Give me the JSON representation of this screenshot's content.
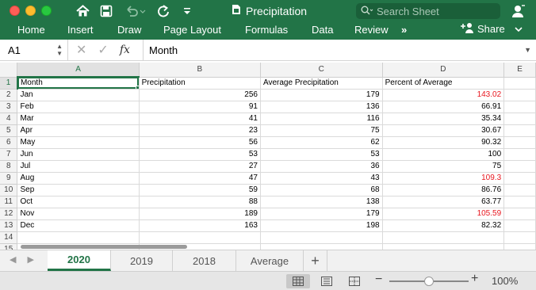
{
  "window": {
    "title": "Precipitation",
    "search_placeholder": "Search Sheet"
  },
  "ribbon": {
    "tabs": [
      "Home",
      "Insert",
      "Draw",
      "Page Layout",
      "Formulas",
      "Data",
      "Review"
    ],
    "more": "»",
    "share_label": "Share"
  },
  "formula_bar": {
    "name_box": "A1",
    "fx_label": "fx",
    "value": "Month"
  },
  "sheet": {
    "columns": [
      "A",
      "B",
      "C",
      "D",
      "E"
    ],
    "row_numbers": [
      "1",
      "2",
      "3",
      "4",
      "5",
      "6",
      "7",
      "8",
      "9",
      "10",
      "11",
      "12",
      "13",
      "14",
      "15"
    ],
    "header": [
      "Month",
      "Precipitation",
      "Average Precipitation",
      "Percent of Average"
    ],
    "rows": [
      {
        "month": "Jan",
        "precip": "256",
        "avg": "179",
        "pct": "143.02",
        "above": true
      },
      {
        "month": "Feb",
        "precip": "91",
        "avg": "136",
        "pct": "66.91",
        "above": false
      },
      {
        "month": "Mar",
        "precip": "41",
        "avg": "116",
        "pct": "35.34",
        "above": false
      },
      {
        "month": "Apr",
        "precip": "23",
        "avg": "75",
        "pct": "30.67",
        "above": false
      },
      {
        "month": "May",
        "precip": "56",
        "avg": "62",
        "pct": "90.32",
        "above": false
      },
      {
        "month": "Jun",
        "precip": "53",
        "avg": "53",
        "pct": "100",
        "above": false
      },
      {
        "month": "Jul",
        "precip": "27",
        "avg": "36",
        "pct": "75",
        "above": false
      },
      {
        "month": "Aug",
        "precip": "47",
        "avg": "43",
        "pct": "109.3",
        "above": true
      },
      {
        "month": "Sep",
        "precip": "59",
        "avg": "68",
        "pct": "86.76",
        "above": false
      },
      {
        "month": "Oct",
        "precip": "88",
        "avg": "138",
        "pct": "63.77",
        "above": false
      },
      {
        "month": "Nov",
        "precip": "189",
        "avg": "179",
        "pct": "105.59",
        "above": true
      },
      {
        "month": "Dec",
        "precip": "163",
        "avg": "198",
        "pct": "82.32",
        "above": false
      }
    ],
    "highlight_color": "#e8171f"
  },
  "sheet_tabs": {
    "tabs": [
      "2020",
      "2019",
      "2018",
      "Average"
    ],
    "active": "2020",
    "add_label": "+"
  },
  "status_bar": {
    "zoom_minus": "−",
    "zoom_plus": "+",
    "zoom_level": "100%",
    "zoom_fraction": 0.5
  },
  "colors": {
    "accent": "#227447"
  }
}
